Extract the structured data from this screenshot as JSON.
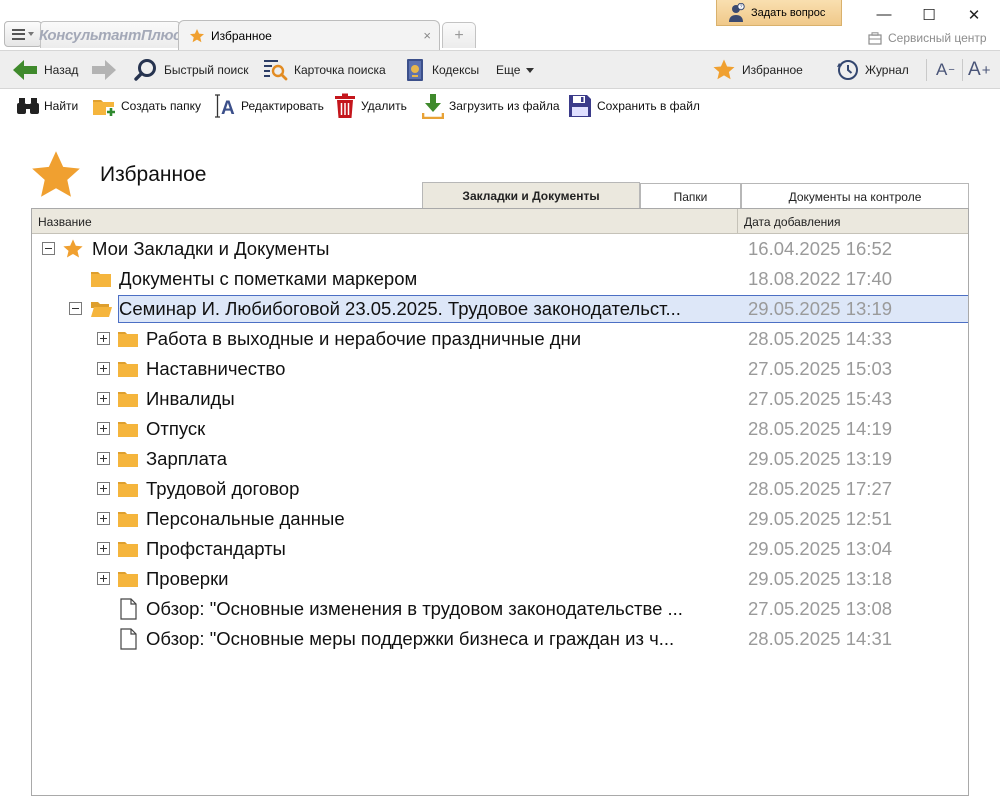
{
  "titlebar": {
    "logo_text": "КонсультантПлюс",
    "active_tab_label": "Избранное",
    "close_glyph": "×",
    "new_tab_glyph": "+",
    "ask_button_label": "Задать вопрос",
    "service_center_label": "Сервисный центр",
    "minimize_glyph": "—",
    "maximize_glyph": "☐",
    "close_window_glyph": "✕"
  },
  "navbar": {
    "back_label": "Назад",
    "quick_search_label": "Быстрый поиск",
    "search_card_label": "Карточка поиска",
    "codes_label": "Кодексы",
    "more_label": "Еще",
    "favorites_label": "Избранное",
    "journal_label": "Журнал",
    "font_smaller_label": "A",
    "font_smaller_suffix": "−",
    "font_larger_label": "A",
    "font_larger_suffix": "+"
  },
  "actions": {
    "find_label": "Найти",
    "create_folder_label": "Создать папку",
    "edit_label": "Редактировать",
    "delete_label": "Удалить",
    "load_from_file_label": "Загрузить из файла",
    "save_to_file_label": "Сохранить в файл"
  },
  "page": {
    "title": "Избранное"
  },
  "tabs": [
    {
      "label": "Закладки и Документы",
      "active": true
    },
    {
      "label": "Папки",
      "active": false
    },
    {
      "label": "Документы на контроле",
      "active": false
    }
  ],
  "columns": {
    "name": "Название",
    "date_added": "Дата добавления"
  },
  "tree": [
    {
      "label": "Мои Закладки и Документы",
      "date": "16.04.2025 16:52",
      "type": "root",
      "expander": "minus",
      "level": 0
    },
    {
      "label": "Документы с пометками маркером",
      "date": "18.08.2022 17:40",
      "type": "folder",
      "expander": "none",
      "level": 1
    },
    {
      "label": "Семинар И. Любибоговой 23.05.2025. Трудовое законодательст...",
      "date": "29.05.2025 13:19",
      "type": "folder-open",
      "expander": "minus",
      "level": 1,
      "selected": true
    },
    {
      "label": "Работа в выходные и нерабочие праздничные дни",
      "date": "28.05.2025 14:33",
      "type": "folder",
      "expander": "plus",
      "level": 2
    },
    {
      "label": "Наставничество",
      "date": "27.05.2025 15:03",
      "type": "folder",
      "expander": "plus",
      "level": 2
    },
    {
      "label": "Инвалиды",
      "date": "27.05.2025 15:43",
      "type": "folder",
      "expander": "plus",
      "level": 2
    },
    {
      "label": "Отпуск",
      "date": "28.05.2025 14:19",
      "type": "folder",
      "expander": "plus",
      "level": 2
    },
    {
      "label": "Зарплата",
      "date": "29.05.2025 13:19",
      "type": "folder",
      "expander": "plus",
      "level": 2
    },
    {
      "label": "Трудовой договор",
      "date": "28.05.2025 17:27",
      "type": "folder",
      "expander": "plus",
      "level": 2
    },
    {
      "label": "Персональные данные",
      "date": "29.05.2025 12:51",
      "type": "folder",
      "expander": "plus",
      "level": 2
    },
    {
      "label": "Профстандарты",
      "date": "29.05.2025 13:04",
      "type": "folder",
      "expander": "plus",
      "level": 2
    },
    {
      "label": "Проверки",
      "date": "29.05.2025 13:18",
      "type": "folder",
      "expander": "plus",
      "level": 2
    },
    {
      "label": "Обзор: \"Основные изменения в трудовом законодательстве ...",
      "date": "27.05.2025 13:08",
      "type": "document",
      "expander": "none",
      "level": 2
    },
    {
      "label": "Обзор: \"Основные меры поддержки бизнеса и граждан из ч...",
      "date": "28.05.2025 14:31",
      "type": "document",
      "expander": "none",
      "level": 2
    }
  ],
  "colors": {
    "accent_star": "#f0a030",
    "folder": "#f5b53d",
    "selection_bg": "#dde7f8",
    "selection_border": "#4c6fc4",
    "date_text": "#9a9a9a",
    "header_bg": "#ebe8de"
  }
}
